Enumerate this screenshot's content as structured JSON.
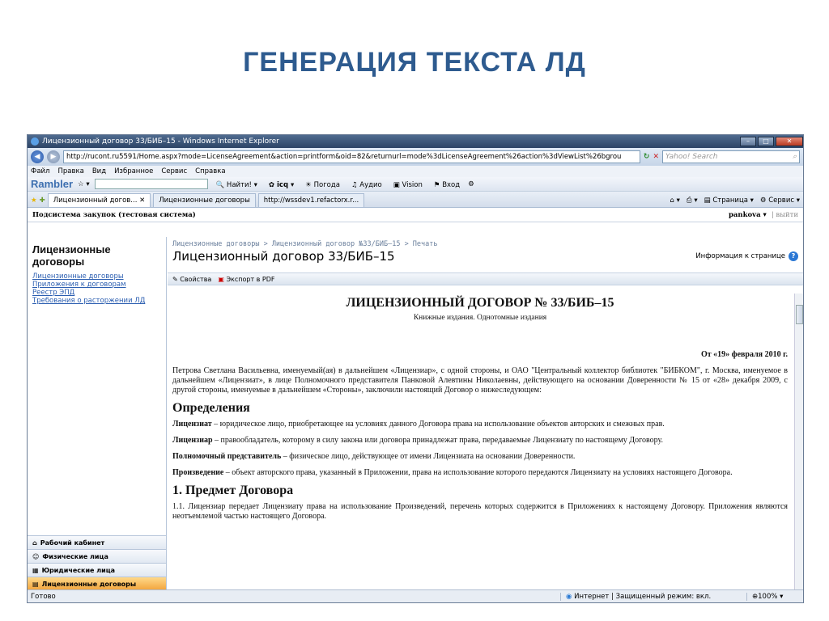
{
  "slide": {
    "title": "ГЕНЕРАЦИЯ ТЕКСТА ЛД"
  },
  "window": {
    "title": "Лицензионный договор 33/БИБ–15 - Windows Internet Explorer",
    "url": "http://rucont.ru5591/Home.aspx?mode=LicenseAgreement&action=printform&oid=82&returnurl=mode%3dLicenseAgreement%26action%3dViewList%26bgrou",
    "search_placeholder": "Yahoo! Search"
  },
  "menu": [
    "Файл",
    "Правка",
    "Вид",
    "Избранное",
    "Сервис",
    "Справка"
  ],
  "toolbar": {
    "brand": "Rambler",
    "find": "Найти!",
    "icq": "icq",
    "weather": "Погода",
    "audio": "Аудио",
    "vision": "Vision",
    "login": "Вход"
  },
  "tabs": [
    {
      "label": "Лицензионный догов...",
      "active": true
    },
    {
      "label": "Лицензионные договоры",
      "active": false
    },
    {
      "label": "http://wssdev1.refactorx.r...",
      "active": false
    }
  ],
  "tab_tools": {
    "page": "Страница",
    "service": "Сервис"
  },
  "subsystem": {
    "label": "Подсистема закупок (тестовая система)",
    "user": "pankova",
    "logout": "выйти"
  },
  "sidebar": {
    "title": "Лицензионные договоры",
    "links": [
      "Лицензионные договоры",
      "Приложения к договорам",
      "Реестр ЭПД",
      "Требования о расторжении ЛД"
    ],
    "nav": [
      {
        "label": "Рабочий кабинет",
        "active": false
      },
      {
        "label": "Физические лица",
        "active": false
      },
      {
        "label": "Юридические лица",
        "active": false
      },
      {
        "label": "Лицензионные договоры",
        "active": true
      }
    ]
  },
  "main": {
    "breadcrumb": "Лицензионные договоры > Лицензионный договор №33/БИБ–15 > Печать",
    "title": "Лицензионный договор 33/БИБ–15",
    "info": "Информация к странице",
    "actions": {
      "properties": "Свойства",
      "export": "Экспорт в PDF"
    }
  },
  "document": {
    "title": "ЛИЦЕНЗИОННЫЙ ДОГОВОР № 33/БИБ–15",
    "subtitle": "Книжные издания. Однотомные издания",
    "date": "От «19» февраля 2010 г.",
    "intro": "Петрова Светлана Васильевна, именуемый(ая) в дальнейшем «Лицензиар», с одной стороны, и ОАО \"Центральный коллектор библиотек \"БИБКОМ\", г. Москва, именуемое в дальнейшем «Лицензиат», в лице Полномочного представителя Панковой Алевтины Николаевны, действующего на основании Доверенности № 15 от «28» декабря 2009, с другой стороны, именуемые в дальнейшем «Стороны», заключили настоящий Договор о нижеследующем:",
    "definitions_heading": "Определения",
    "definitions": [
      {
        "term": "Лицензиат",
        "text": " – юридическое лицо, приобретающее на условиях данного Договора права на использование объектов авторских и смежных прав."
      },
      {
        "term": "Лицензиар",
        "text": " – правообладатель, которому в силу закона или договора принадлежат права, передаваемые Лицензиату по настоящему Договору."
      },
      {
        "term": "Полномочный представитель",
        "text": " – физическое лицо, действующее от имени Лицензиата на основании Доверенности."
      },
      {
        "term": "Произведение",
        "text": " – объект авторского права, указанный в Приложении, права на использование которого передаются Лицензиату на условиях настоящего Договора."
      }
    ],
    "section1_heading": "1. Предмет Договора",
    "section1_text": "1.1. Лицензиар передает Лицензиату права на использование Произведений, перечень которых содержится в Приложениях к настоящему Договору. Приложения являются неотъемлемой частью настоящего Договора."
  },
  "status": {
    "left": "Готово",
    "zone": "Интернет | Защищенный режим: вкл.",
    "zoom": "100%"
  }
}
